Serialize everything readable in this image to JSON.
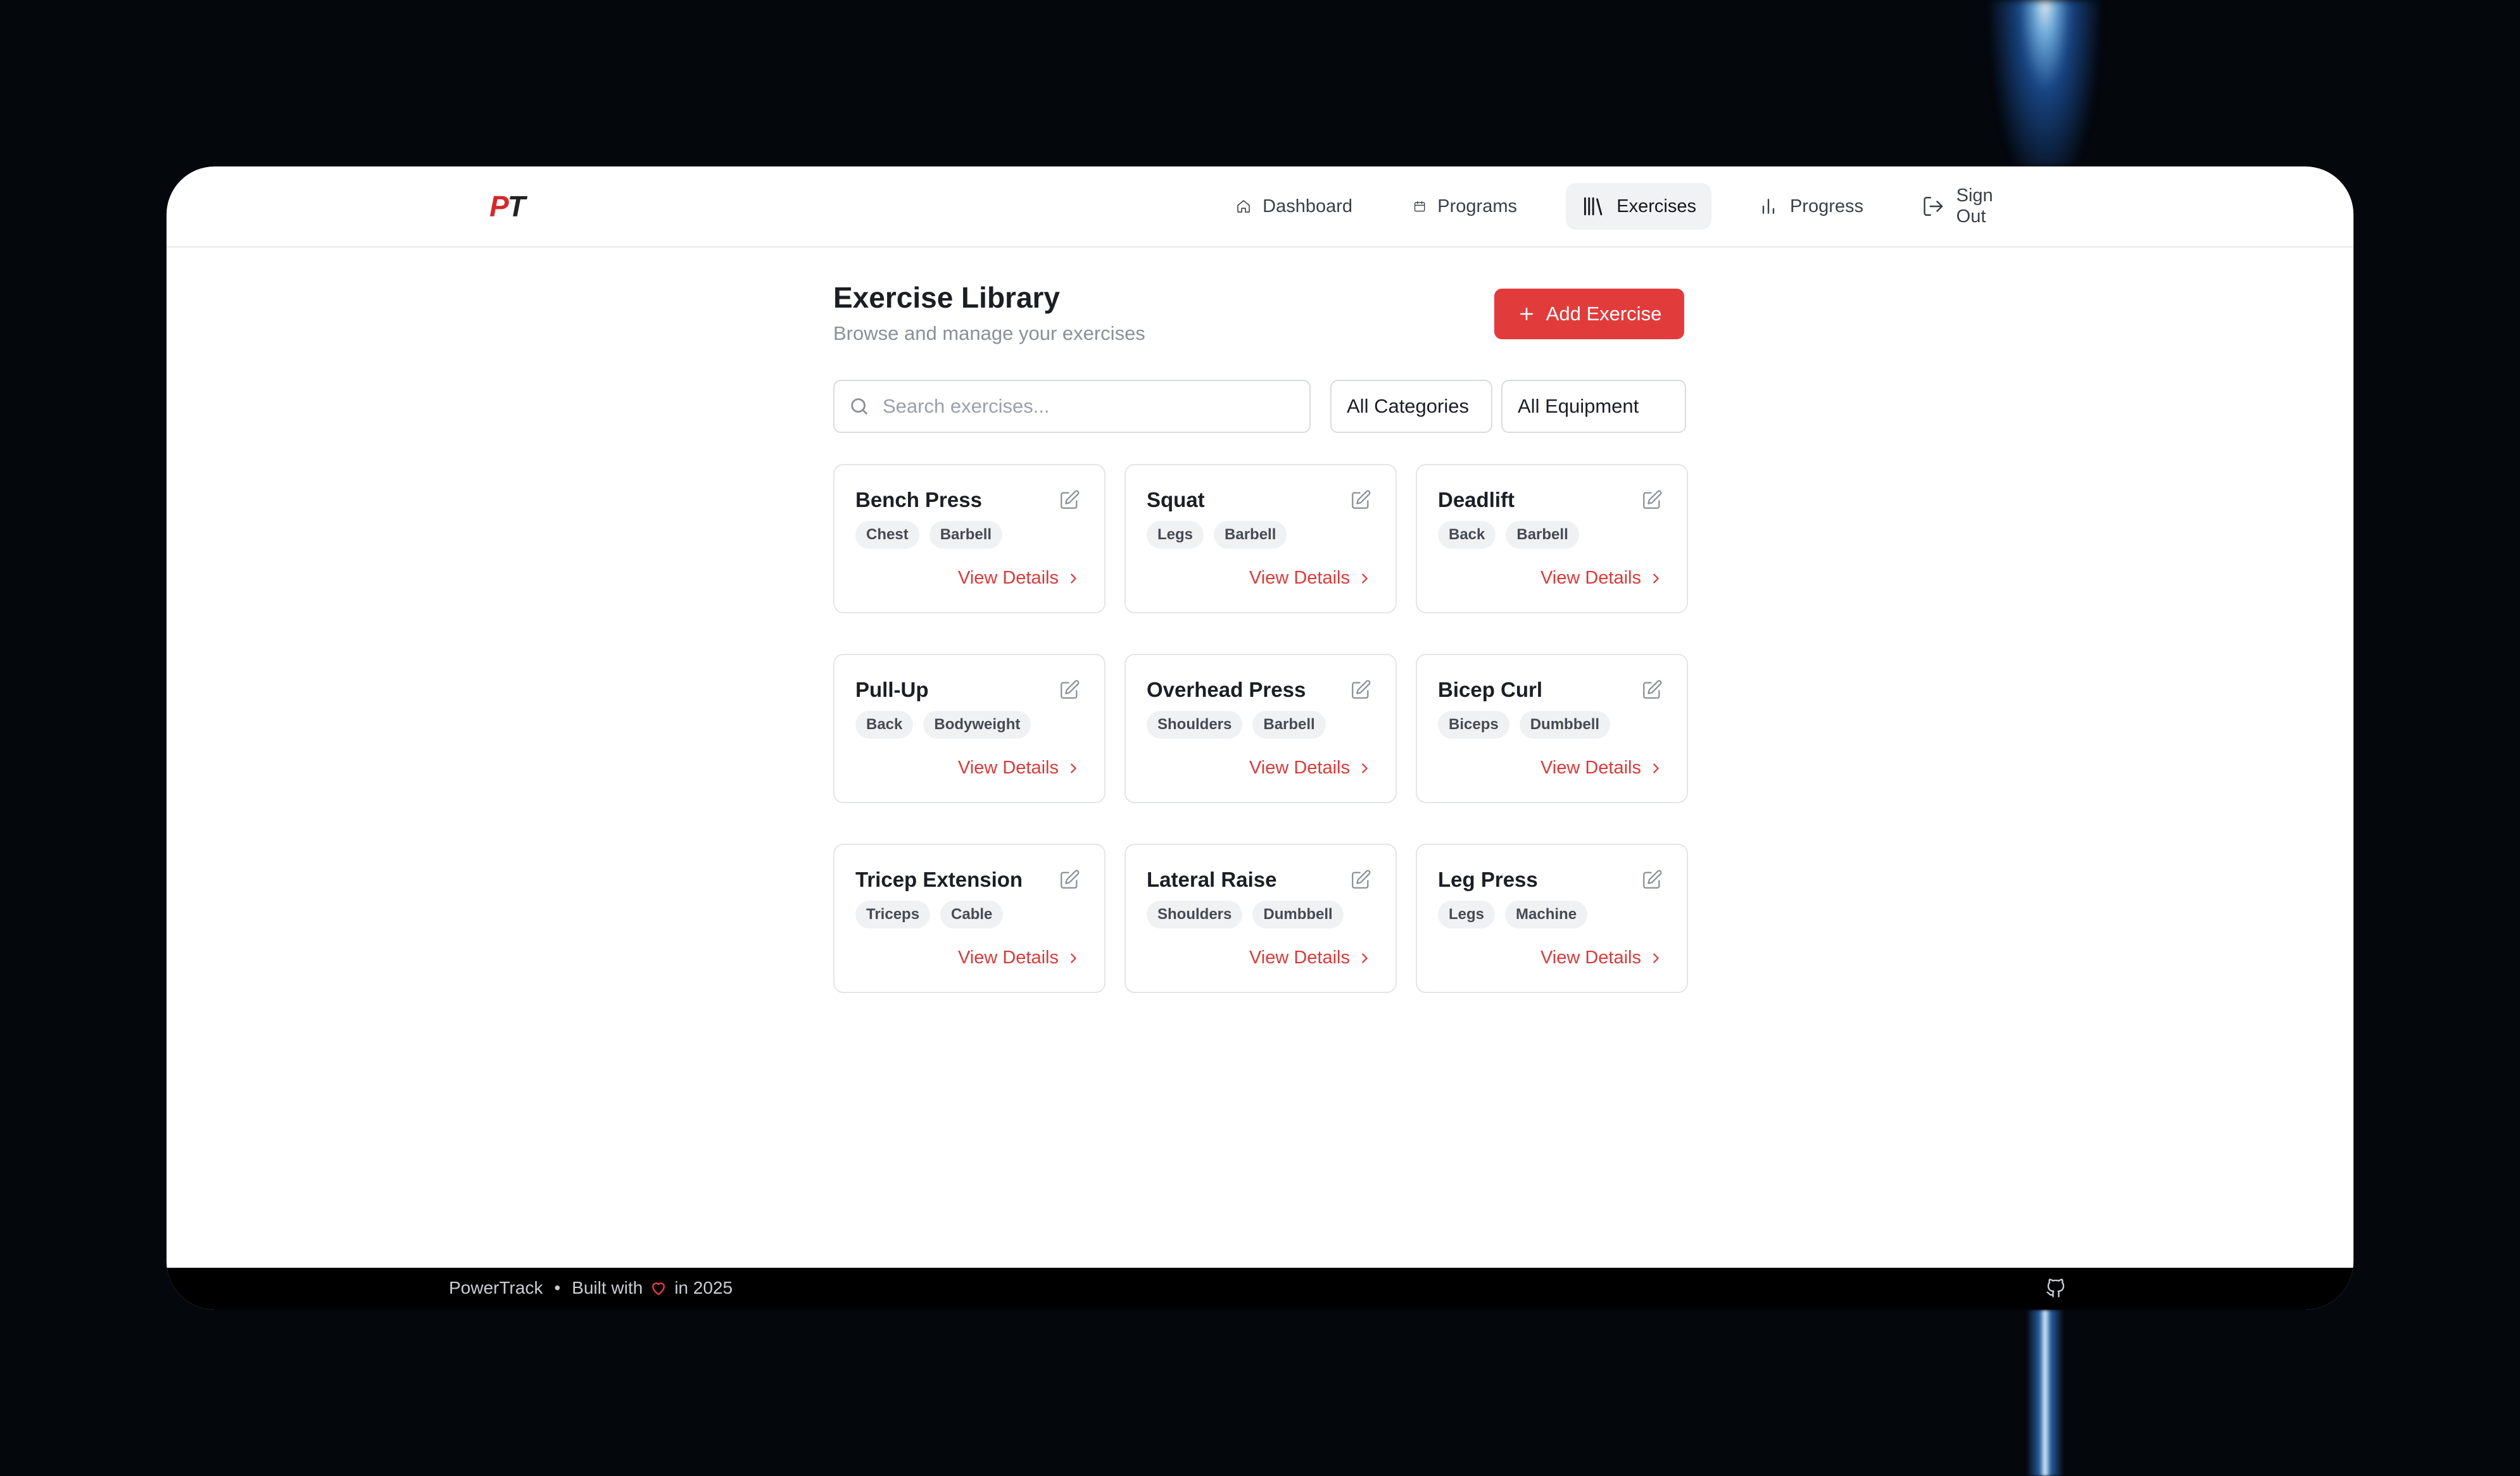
{
  "brand": {
    "logo_p": "P",
    "logo_t": "T",
    "name": "PowerTrack"
  },
  "nav": [
    {
      "label": "Dashboard",
      "icon": "home-icon"
    },
    {
      "label": "Programs",
      "icon": "calendar-icon"
    },
    {
      "label": "Exercises",
      "icon": "library-icon",
      "active": true
    },
    {
      "label": "Progress",
      "icon": "bar-chart-icon"
    },
    {
      "label": "Sign Out",
      "icon": "sign-out-icon"
    }
  ],
  "page": {
    "title": "Exercise Library",
    "subtitle": "Browse and manage your exercises",
    "add_button": "Add Exercise"
  },
  "filters": {
    "search_placeholder": "Search exercises...",
    "category": "All Categories",
    "equipment": "All Equipment"
  },
  "exercises": [
    {
      "name": "Bench Press",
      "category": "Chest",
      "equipment": "Barbell",
      "link": "View Details"
    },
    {
      "name": "Squat",
      "category": "Legs",
      "equipment": "Barbell",
      "link": "View Details"
    },
    {
      "name": "Deadlift",
      "category": "Back",
      "equipment": "Barbell",
      "link": "View Details"
    },
    {
      "name": "Pull-Up",
      "category": "Back",
      "equipment": "Bodyweight",
      "link": "View Details"
    },
    {
      "name": "Overhead Press",
      "category": "Shoulders",
      "equipment": "Barbell",
      "link": "View Details"
    },
    {
      "name": "Bicep Curl",
      "category": "Biceps",
      "equipment": "Dumbbell",
      "link": "View Details"
    },
    {
      "name": "Tricep Extension",
      "category": "Triceps",
      "equipment": "Cable",
      "link": "View Details"
    },
    {
      "name": "Lateral Raise",
      "category": "Shoulders",
      "equipment": "Dumbbell",
      "link": "View Details"
    },
    {
      "name": "Leg Press",
      "category": "Legs",
      "equipment": "Machine",
      "link": "View Details"
    }
  ],
  "footer": {
    "brand": "PowerTrack",
    "separator": "•",
    "built_with": "Built with",
    "year_text": "in 2025"
  },
  "colors": {
    "accent": "#e23b3b",
    "link": "#d93a3a",
    "footer_bg": "#000000"
  }
}
